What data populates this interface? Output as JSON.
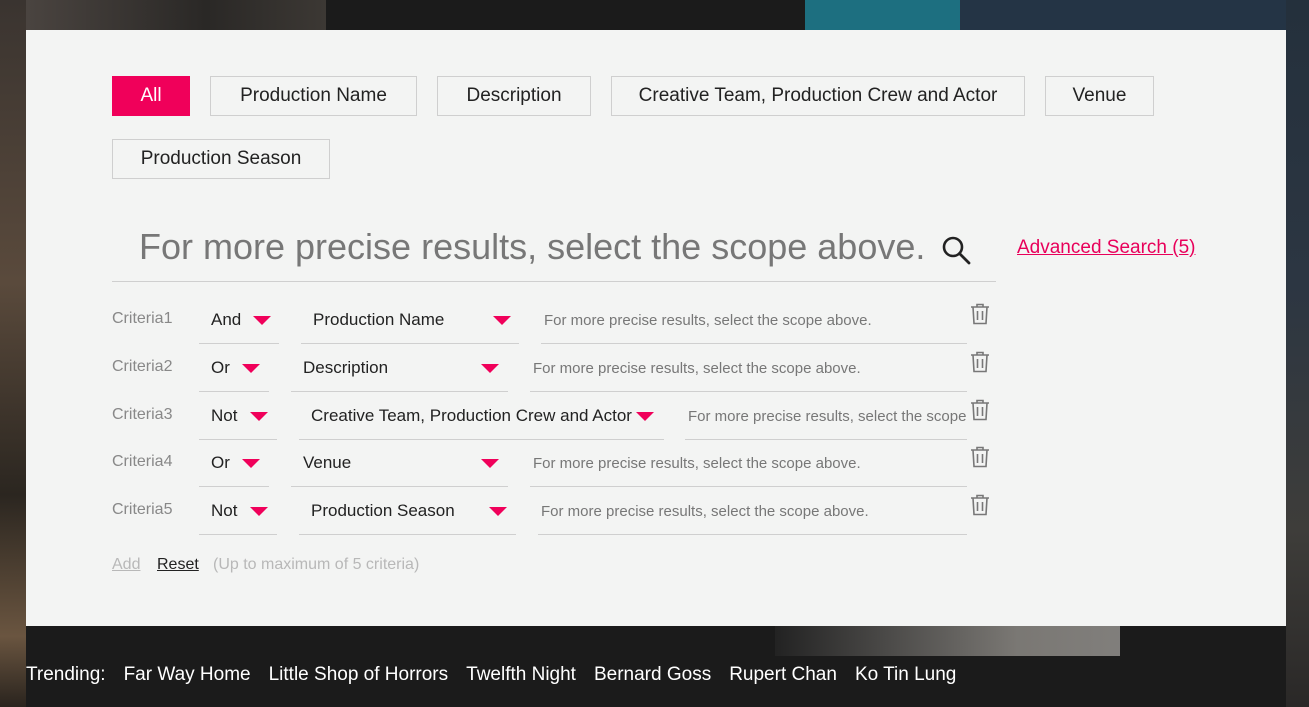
{
  "scope_tabs": [
    {
      "label": "All",
      "active": true
    },
    {
      "label": "Production Name",
      "active": false
    },
    {
      "label": "Description",
      "active": false
    },
    {
      "label": "Creative Team, Production Crew and Actor",
      "active": false
    },
    {
      "label": "Venue",
      "active": false
    },
    {
      "label": "Production Season",
      "active": false
    }
  ],
  "search": {
    "placeholder": "For more precise results, select the scope above.",
    "value": ""
  },
  "advanced_search": {
    "label": "Advanced Search (5)"
  },
  "criteria": [
    {
      "label": "Criteria1",
      "operator": "And",
      "field": "Production Name",
      "placeholder": "For more precise results, select the scope above."
    },
    {
      "label": "Criteria2",
      "operator": "Or",
      "field": "Description",
      "placeholder": "For more precise results, select the scope above."
    },
    {
      "label": "Criteria3",
      "operator": "Not",
      "field": "Creative Team, Production Crew and Actor",
      "placeholder": "For more precise results, select the scope above."
    },
    {
      "label": "Criteria4",
      "operator": "Or",
      "field": "Venue",
      "placeholder": "For more precise results, select the scope above."
    },
    {
      "label": "Criteria5",
      "operator": "Not",
      "field": "Production Season",
      "placeholder": "For more precise results, select the scope above."
    }
  ],
  "actions": {
    "add": "Add",
    "reset": "Reset",
    "note": "(Up to maximum of 5 criteria)"
  },
  "trending": {
    "label": "Trending:",
    "items": [
      "Far Way Home",
      "Little Shop of Horrors",
      "Twelfth Night",
      "Bernard Goss",
      "Rupert Chan",
      "Ko Tin Lung"
    ]
  },
  "colors": {
    "accent": "#f0005a",
    "panel": "#f3f4f3",
    "background": "#1b1b1b"
  },
  "icons": {
    "search": "search-icon",
    "delete": "trash-icon",
    "dropdown": "caret-down-icon"
  }
}
